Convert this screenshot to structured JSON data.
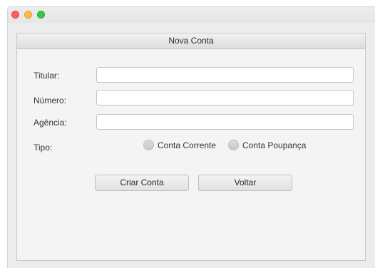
{
  "window": {
    "controls": [
      "close",
      "minimize",
      "maximize"
    ]
  },
  "form": {
    "title": "Nova Conta",
    "titular": {
      "label": "Titular:",
      "value": "",
      "placeholder": ""
    },
    "numero": {
      "label": "Número:",
      "value": "",
      "placeholder": ""
    },
    "agencia": {
      "label": "Agência:",
      "value": "",
      "placeholder": ""
    },
    "tipo": {
      "label": "Tipo:",
      "options": [
        {
          "label": "Conta Corrente",
          "selected": false
        },
        {
          "label": "Conta Poupança",
          "selected": false
        }
      ]
    },
    "buttons": {
      "criar": "Criar Conta",
      "voltar": "Voltar"
    }
  }
}
